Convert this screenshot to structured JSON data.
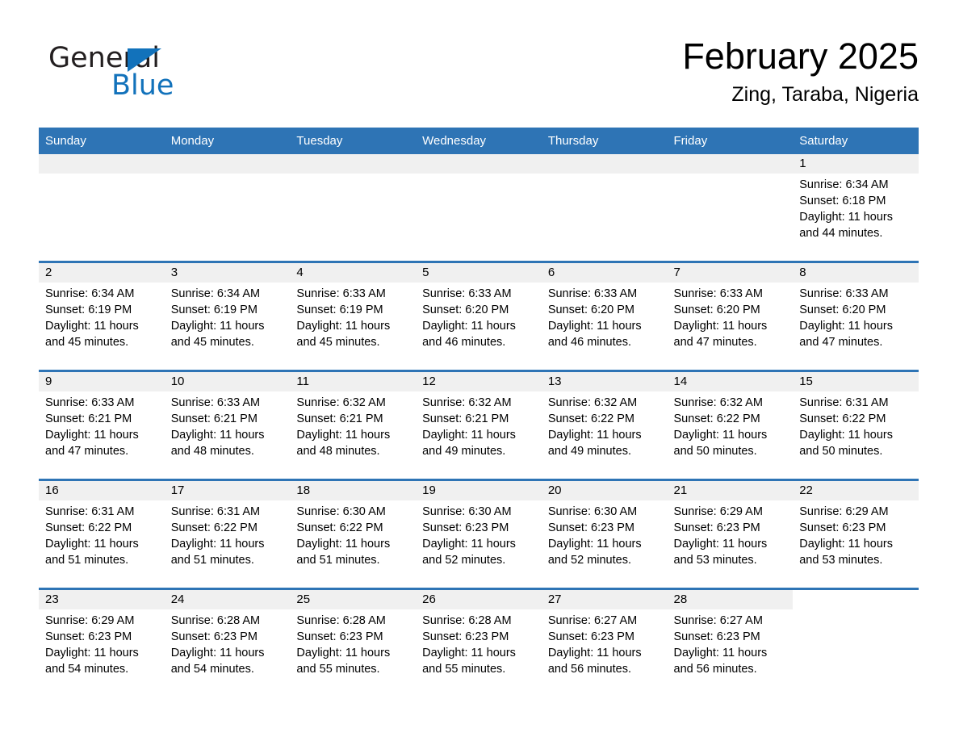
{
  "logo": {
    "word1": "General",
    "word2": "Blue",
    "triangle_color": "#1272bb",
    "text_color": "#231f20"
  },
  "header": {
    "title": "February 2025",
    "subtitle": "Zing, Taraba, Nigeria"
  },
  "theme": {
    "header_blue": "#2e74b5",
    "row_rule_blue": "#2e74b5",
    "daynum_band": "#f0f0f0",
    "page_background": "#ffffff"
  },
  "weekdays": [
    "Sunday",
    "Monday",
    "Tuesday",
    "Wednesday",
    "Thursday",
    "Friday",
    "Saturday"
  ],
  "labels": {
    "sunrise_prefix": "Sunrise:",
    "sunset_prefix": "Sunset:",
    "daylight_prefix": "Daylight:"
  },
  "weeks": [
    [
      {
        "day": "",
        "lines": []
      },
      {
        "day": "",
        "lines": []
      },
      {
        "day": "",
        "lines": []
      },
      {
        "day": "",
        "lines": []
      },
      {
        "day": "",
        "lines": []
      },
      {
        "day": "",
        "lines": []
      },
      {
        "day": "1",
        "lines": [
          "Sunrise: 6:34 AM",
          "Sunset: 6:18 PM",
          "Daylight: 11 hours and 44 minutes."
        ]
      }
    ],
    [
      {
        "day": "2",
        "lines": [
          "Sunrise: 6:34 AM",
          "Sunset: 6:19 PM",
          "Daylight: 11 hours and 45 minutes."
        ]
      },
      {
        "day": "3",
        "lines": [
          "Sunrise: 6:34 AM",
          "Sunset: 6:19 PM",
          "Daylight: 11 hours and 45 minutes."
        ]
      },
      {
        "day": "4",
        "lines": [
          "Sunrise: 6:33 AM",
          "Sunset: 6:19 PM",
          "Daylight: 11 hours and 45 minutes."
        ]
      },
      {
        "day": "5",
        "lines": [
          "Sunrise: 6:33 AM",
          "Sunset: 6:20 PM",
          "Daylight: 11 hours and 46 minutes."
        ]
      },
      {
        "day": "6",
        "lines": [
          "Sunrise: 6:33 AM",
          "Sunset: 6:20 PM",
          "Daylight: 11 hours and 46 minutes."
        ]
      },
      {
        "day": "7",
        "lines": [
          "Sunrise: 6:33 AM",
          "Sunset: 6:20 PM",
          "Daylight: 11 hours and 47 minutes."
        ]
      },
      {
        "day": "8",
        "lines": [
          "Sunrise: 6:33 AM",
          "Sunset: 6:20 PM",
          "Daylight: 11 hours and 47 minutes."
        ]
      }
    ],
    [
      {
        "day": "9",
        "lines": [
          "Sunrise: 6:33 AM",
          "Sunset: 6:21 PM",
          "Daylight: 11 hours and 47 minutes."
        ]
      },
      {
        "day": "10",
        "lines": [
          "Sunrise: 6:33 AM",
          "Sunset: 6:21 PM",
          "Daylight: 11 hours and 48 minutes."
        ]
      },
      {
        "day": "11",
        "lines": [
          "Sunrise: 6:32 AM",
          "Sunset: 6:21 PM",
          "Daylight: 11 hours and 48 minutes."
        ]
      },
      {
        "day": "12",
        "lines": [
          "Sunrise: 6:32 AM",
          "Sunset: 6:21 PM",
          "Daylight: 11 hours and 49 minutes."
        ]
      },
      {
        "day": "13",
        "lines": [
          "Sunrise: 6:32 AM",
          "Sunset: 6:22 PM",
          "Daylight: 11 hours and 49 minutes."
        ]
      },
      {
        "day": "14",
        "lines": [
          "Sunrise: 6:32 AM",
          "Sunset: 6:22 PM",
          "Daylight: 11 hours and 50 minutes."
        ]
      },
      {
        "day": "15",
        "lines": [
          "Sunrise: 6:31 AM",
          "Sunset: 6:22 PM",
          "Daylight: 11 hours and 50 minutes."
        ]
      }
    ],
    [
      {
        "day": "16",
        "lines": [
          "Sunrise: 6:31 AM",
          "Sunset: 6:22 PM",
          "Daylight: 11 hours and 51 minutes."
        ]
      },
      {
        "day": "17",
        "lines": [
          "Sunrise: 6:31 AM",
          "Sunset: 6:22 PM",
          "Daylight: 11 hours and 51 minutes."
        ]
      },
      {
        "day": "18",
        "lines": [
          "Sunrise: 6:30 AM",
          "Sunset: 6:22 PM",
          "Daylight: 11 hours and 51 minutes."
        ]
      },
      {
        "day": "19",
        "lines": [
          "Sunrise: 6:30 AM",
          "Sunset: 6:23 PM",
          "Daylight: 11 hours and 52 minutes."
        ]
      },
      {
        "day": "20",
        "lines": [
          "Sunrise: 6:30 AM",
          "Sunset: 6:23 PM",
          "Daylight: 11 hours and 52 minutes."
        ]
      },
      {
        "day": "21",
        "lines": [
          "Sunrise: 6:29 AM",
          "Sunset: 6:23 PM",
          "Daylight: 11 hours and 53 minutes."
        ]
      },
      {
        "day": "22",
        "lines": [
          "Sunrise: 6:29 AM",
          "Sunset: 6:23 PM",
          "Daylight: 11 hours and 53 minutes."
        ]
      }
    ],
    [
      {
        "day": "23",
        "lines": [
          "Sunrise: 6:29 AM",
          "Sunset: 6:23 PM",
          "Daylight: 11 hours and 54 minutes."
        ]
      },
      {
        "day": "24",
        "lines": [
          "Sunrise: 6:28 AM",
          "Sunset: 6:23 PM",
          "Daylight: 11 hours and 54 minutes."
        ]
      },
      {
        "day": "25",
        "lines": [
          "Sunrise: 6:28 AM",
          "Sunset: 6:23 PM",
          "Daylight: 11 hours and 55 minutes."
        ]
      },
      {
        "day": "26",
        "lines": [
          "Sunrise: 6:28 AM",
          "Sunset: 6:23 PM",
          "Daylight: 11 hours and 55 minutes."
        ]
      },
      {
        "day": "27",
        "lines": [
          "Sunrise: 6:27 AM",
          "Sunset: 6:23 PM",
          "Daylight: 11 hours and 56 minutes."
        ]
      },
      {
        "day": "28",
        "lines": [
          "Sunrise: 6:27 AM",
          "Sunset: 6:23 PM",
          "Daylight: 11 hours and 56 minutes."
        ]
      },
      {
        "day": "",
        "lines": []
      }
    ]
  ]
}
